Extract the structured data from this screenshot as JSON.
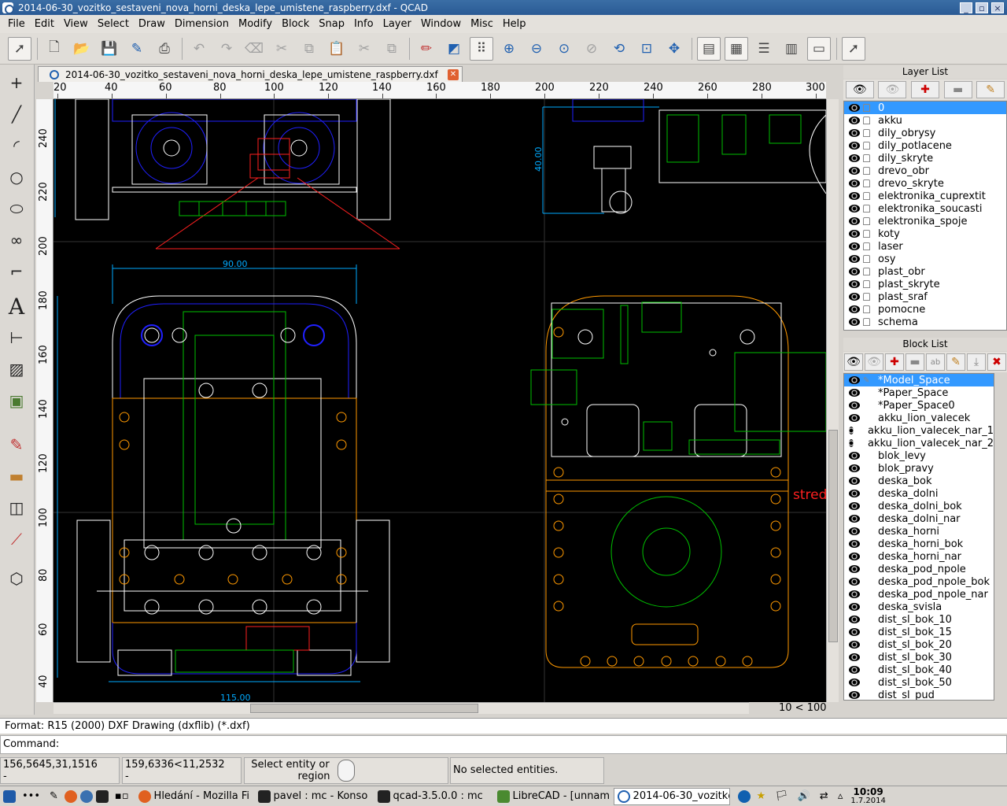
{
  "window": {
    "title": "2014-06-30_vozitko_sestaveni_nova_horni_deska_lepe_umistene_raspberry.dxf - QCAD"
  },
  "menu": [
    "File",
    "Edit",
    "View",
    "Select",
    "Draw",
    "Dimension",
    "Modify",
    "Block",
    "Snap",
    "Info",
    "Layer",
    "Window",
    "Misc",
    "Help"
  ],
  "document_tab": {
    "label": "2014-06-30_vozitko_sestaveni_nova_horni_deska_lepe_umistene_raspberry.dxf"
  },
  "ruler_h": [
    "20",
    "40",
    "60",
    "80",
    "100",
    "120",
    "140",
    "160",
    "180",
    "200",
    "220",
    "240",
    "260",
    "280",
    "300"
  ],
  "ruler_v": [
    "240",
    "220",
    "200",
    "180",
    "160",
    "140",
    "120",
    "100",
    "80",
    "60",
    "40"
  ],
  "drawing": {
    "dim_90": "90.00",
    "dim_40": "40.00",
    "dim_115": "115.00",
    "label_stred": "stred"
  },
  "zoom": "10 < 100",
  "layer_panel": {
    "title": "Layer List",
    "layers": [
      "0",
      "akku",
      "dily_obrysy",
      "dily_potlacene",
      "dily_skryte",
      "drevo_obr",
      "drevo_skryte",
      "elektronika_cuprextit",
      "elektronika_soucasti",
      "elektronika_spoje",
      "koty",
      "laser",
      "osy",
      "plast_obr",
      "plast_skryte",
      "plast_sraf",
      "pomocne",
      "schema"
    ],
    "selected": "0"
  },
  "block_panel": {
    "title": "Block List",
    "blocks": [
      "*Model_Space",
      "*Paper_Space",
      "*Paper_Space0",
      "akku_lion_valecek",
      "akku_lion_valecek_nar_1",
      "akku_lion_valecek_nar_2",
      "blok_levy",
      "blok_pravy",
      "deska_bok",
      "deska_dolni",
      "deska_dolni_bok",
      "deska_dolni_nar",
      "deska_horni",
      "deska_horni_bok",
      "deska_horni_nar",
      "deska_pod_npole",
      "deska_pod_npole_bok",
      "deska_pod_npole_nar",
      "deska_svisla",
      "dist_sl_bok_10",
      "dist_sl_bok_15",
      "dist_sl_bok_20",
      "dist_sl_bok_30",
      "dist_sl_bok_40",
      "dist_sl_bok_50",
      "dist_sl_pud"
    ],
    "selected": "*Model_Space"
  },
  "command_output": "Format: R15 (2000) DXF Drawing (dxflib) (*.dxf)",
  "command_label": "Command:",
  "status": {
    "abs_coord": "156,5645,31,1516",
    "rel_coord": "159,6336<11,2532",
    "dash1": "-",
    "dash2": "-",
    "hint_line1": "Select entity or",
    "hint_line2": "region",
    "selection": "No selected entities."
  },
  "taskbar": {
    "tasks": [
      "Hledání - Mozilla Fi",
      "pavel : mc - Konso",
      "qcad-3.5.0.0 : mc",
      "LibreCAD - [unnam",
      "2014-06-30_vozitkc"
    ],
    "time": "10:09",
    "date": "1.7.2014"
  },
  "colors": {
    "canvas": "#000000",
    "selection": "#3399ff",
    "dimension": "#00aaff",
    "outline_orange": "#ff9900",
    "pcb_green": "#00c000",
    "pcb_blue": "#2020ff",
    "red": "#ff2020"
  }
}
